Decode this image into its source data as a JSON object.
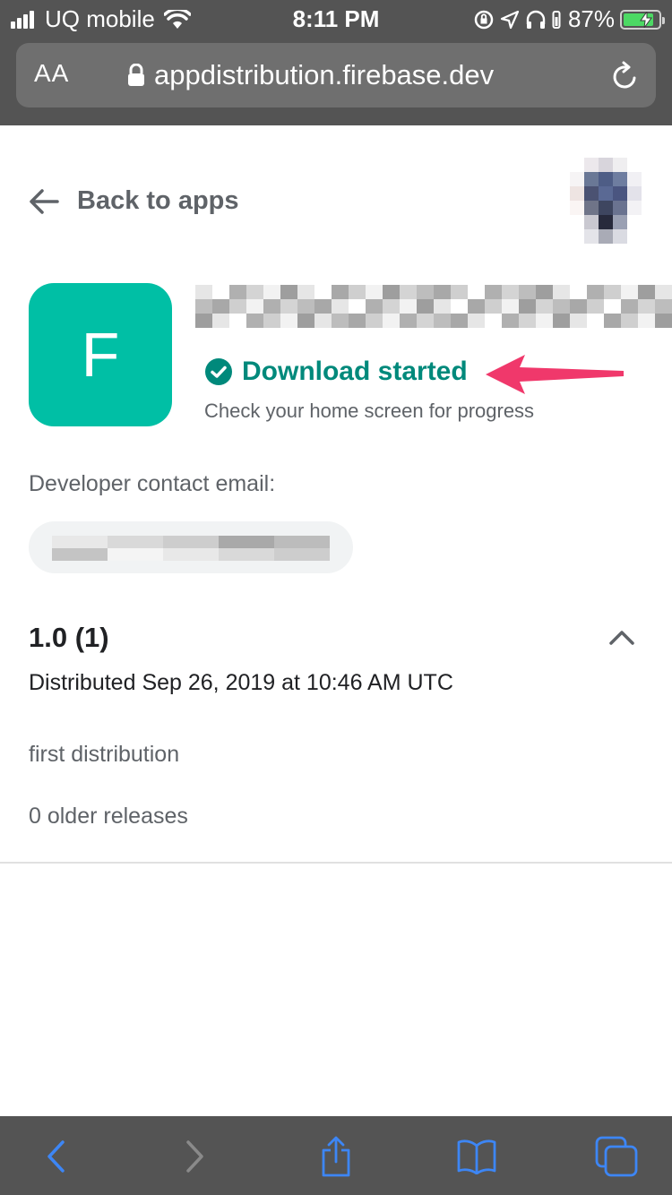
{
  "status_bar": {
    "carrier": "UQ mobile",
    "time": "8:11 PM",
    "battery_percent": "87%",
    "battery_level": 0.87
  },
  "browser": {
    "text_size_label": "AA",
    "url": "appdistribution.firebase.dev"
  },
  "page": {
    "back_label": "Back to apps",
    "app_initial": "F",
    "app_icon_color": "#00bfa5",
    "download_status": "Download started",
    "download_status_color": "#00897b",
    "progress_hint": "Check your home screen for progress",
    "developer_contact_label": "Developer contact email:",
    "release": {
      "version": "1.0 (1)",
      "distributed": "Distributed Sep 26, 2019 at 10:46 AM UTC",
      "notes": "first distribution",
      "older_releases": "0 older releases"
    },
    "annotation_arrow_color": "#f0386b"
  },
  "toolbar": {
    "accent_color": "#3d86f5",
    "icons": [
      "back-icon",
      "forward-icon",
      "share-icon",
      "bookmarks-icon",
      "tabs-icon"
    ]
  }
}
